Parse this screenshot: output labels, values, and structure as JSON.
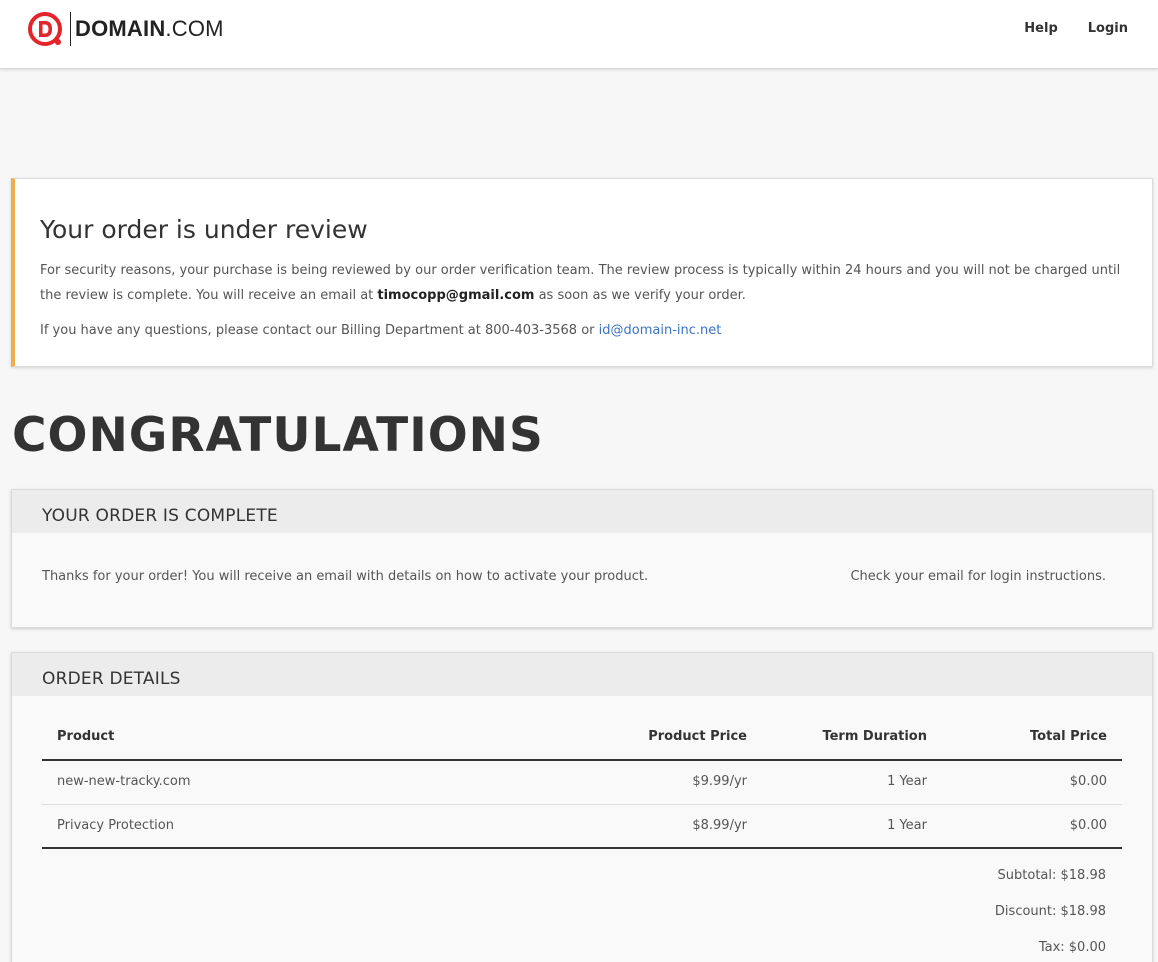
{
  "header": {
    "logo_brand": "DOMAIN",
    "logo_suffix": ".COM",
    "nav": {
      "help": "Help",
      "login": "Login"
    }
  },
  "review": {
    "title": "Your order is under review",
    "message_part1": "For security reasons, your purchase is being reviewed by our order verification team. The review process is typically within 24 hours and you will not be charged until the review is complete. You will receive an email at ",
    "email": "timocopp@gmail.com",
    "message_part2": " as soon as we verify your order.",
    "contact_text": "If you have any questions, please contact our Billing Department at 800-403-3568 or ",
    "contact_email": "id@domain-inc.net"
  },
  "congrats": "CONGRATULATIONS",
  "order_complete": {
    "heading": "YOUR ORDER IS COMPLETE",
    "message": "Thanks for your order! You will receive an email with details on how to activate your product.",
    "login_note": "Check your email for login instructions."
  },
  "order_details": {
    "heading": "ORDER DETAILS",
    "columns": [
      "Product",
      "Product Price",
      "Term Duration",
      "Total Price"
    ],
    "rows": [
      [
        "new-new-tracky.com",
        "$9.99/yr",
        "1 Year",
        "$0.00"
      ],
      [
        "Privacy Protection",
        "$8.99/yr",
        "1 Year",
        "$0.00"
      ]
    ],
    "totals": {
      "subtotal": "Subtotal: $18.98",
      "discount": "Discount: $18.98",
      "tax": "Tax: $0.00"
    }
  },
  "colors": {
    "brand_red": "#e4232a",
    "review_accent": "#f0ad4e",
    "link": "#3a74c2"
  }
}
